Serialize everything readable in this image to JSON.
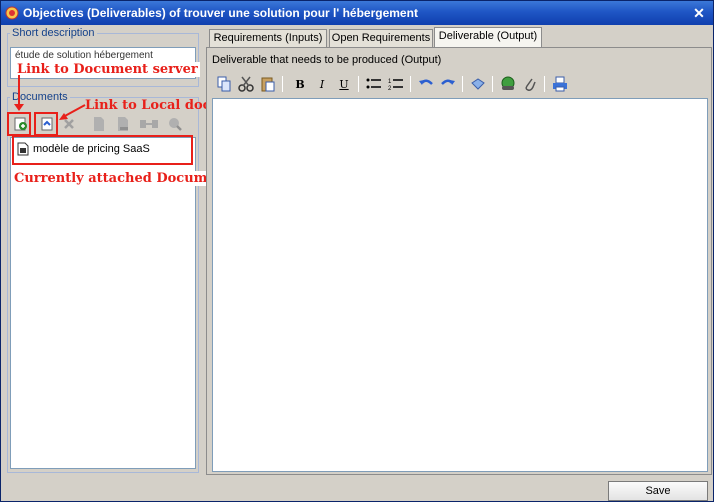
{
  "window": {
    "title": "Objectives (Deliverables) of  trouver une solution pour l' hébergement"
  },
  "left": {
    "short_description_label": "Short description",
    "short_description_value": "étude de solution hébergement",
    "documents_label": "Documents",
    "documents": [
      {
        "name": "modèle de pricing SaaS"
      }
    ]
  },
  "annotations": {
    "document_server": "Link to Document server",
    "local_document": "Link to Local document",
    "attached_document": "Currently attached Document"
  },
  "tabs": [
    {
      "label": "Requirements (Inputs)"
    },
    {
      "label": "Open Requirements"
    },
    {
      "label": "Deliverable (Output)",
      "active": true
    }
  ],
  "editor": {
    "label": "Deliverable that needs to be produced (Output)",
    "content": ""
  },
  "footer": {
    "save_label": "Save"
  },
  "colors": {
    "title_bar": "#1f56c5",
    "annotation": "#e8201a",
    "legend_text": "#15428b"
  }
}
